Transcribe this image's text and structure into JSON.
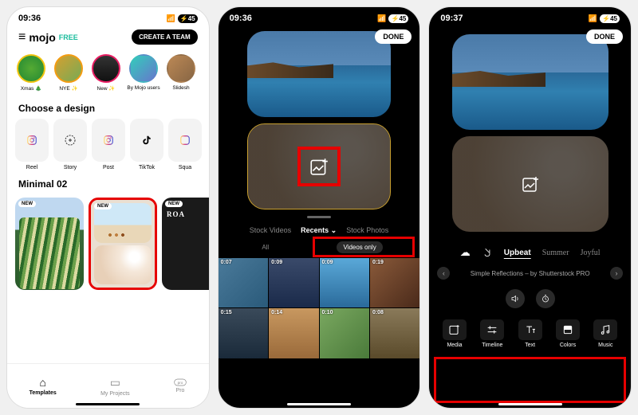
{
  "screen1": {
    "status": {
      "time": "09:36",
      "battery": "45"
    },
    "header": {
      "menu_icon": "≡",
      "brand": "mojo",
      "plan": "FREE",
      "cta": "CREATE A TEAM"
    },
    "stories": [
      {
        "label": "Xmas 🎄"
      },
      {
        "label": "NYE ✨"
      },
      {
        "label": "New ✨"
      },
      {
        "label": "By Mojo users"
      },
      {
        "label": "Slidesh"
      }
    ],
    "choose_title": "Choose a design",
    "designs": [
      {
        "label": "Reel",
        "icon": "ig"
      },
      {
        "label": "Story",
        "icon": "plus"
      },
      {
        "label": "Post",
        "icon": "ig"
      },
      {
        "label": "TikTok",
        "icon": "tt"
      },
      {
        "label": "Squa",
        "icon": "ig"
      }
    ],
    "section_title": "Minimal 02",
    "templates": [
      {
        "badge": "NEW"
      },
      {
        "badge": "NEW"
      },
      {
        "title": "ROA"
      }
    ],
    "nav": [
      {
        "label": "Templates"
      },
      {
        "label": "My Projects"
      },
      {
        "label": "Pro"
      }
    ]
  },
  "screen2": {
    "status": {
      "time": "09:36",
      "battery": "45"
    },
    "done": "DONE",
    "tabs": {
      "left": "Stock Videos",
      "center": "Recents",
      "right": "Stock Photos"
    },
    "filters": {
      "all": "All",
      "videos": "Videos only"
    },
    "durations": [
      "0:07",
      "0:09",
      "0:09",
      "0:19",
      "0:15",
      "0:14",
      "0:10",
      "0:08"
    ]
  },
  "screen3": {
    "status": {
      "time": "09:37",
      "battery": "45"
    },
    "done": "DONE",
    "moods": [
      "Upbeat",
      "Summer",
      "Joyful"
    ],
    "track": "Simple Reflections – by Shutterstock PRO",
    "tools": [
      {
        "label": "Media"
      },
      {
        "label": "Timeline"
      },
      {
        "label": "Text"
      },
      {
        "label": "Colors"
      },
      {
        "label": "Music"
      }
    ]
  }
}
